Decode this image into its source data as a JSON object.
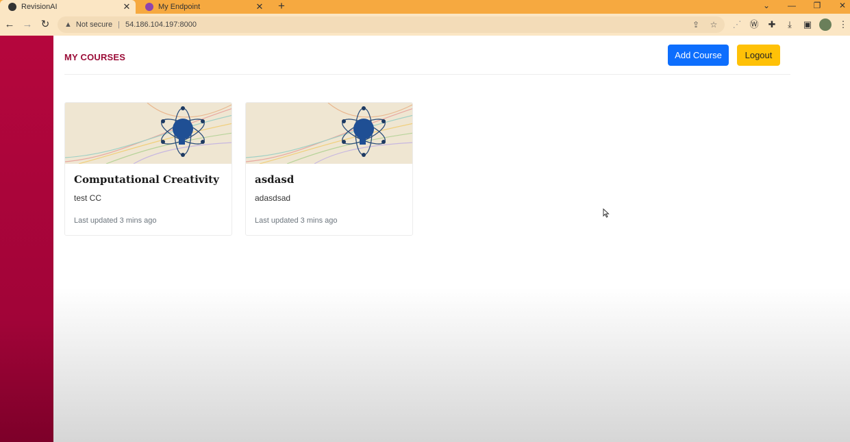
{
  "browser": {
    "tabs": [
      {
        "title": "RevisionAI",
        "active": true
      },
      {
        "title": "My Endpoint",
        "active": false
      }
    ],
    "security_label": "Not secure",
    "url": "54.186.104.197:8000"
  },
  "header": {
    "title": "MY COURSES",
    "add_course_label": "Add Course",
    "logout_label": "Logout"
  },
  "courses": [
    {
      "title": "Computational Creativity",
      "description": "test CC",
      "updated": "Last updated 3 mins ago"
    },
    {
      "title": "asdasd",
      "description": "adasdsad",
      "updated": "Last updated 3 mins ago"
    }
  ],
  "colors": {
    "sidebar": "#b5063d",
    "brand_text": "#9b0d38",
    "primary_button": "#0d6efd",
    "warning_button": "#ffc107"
  }
}
